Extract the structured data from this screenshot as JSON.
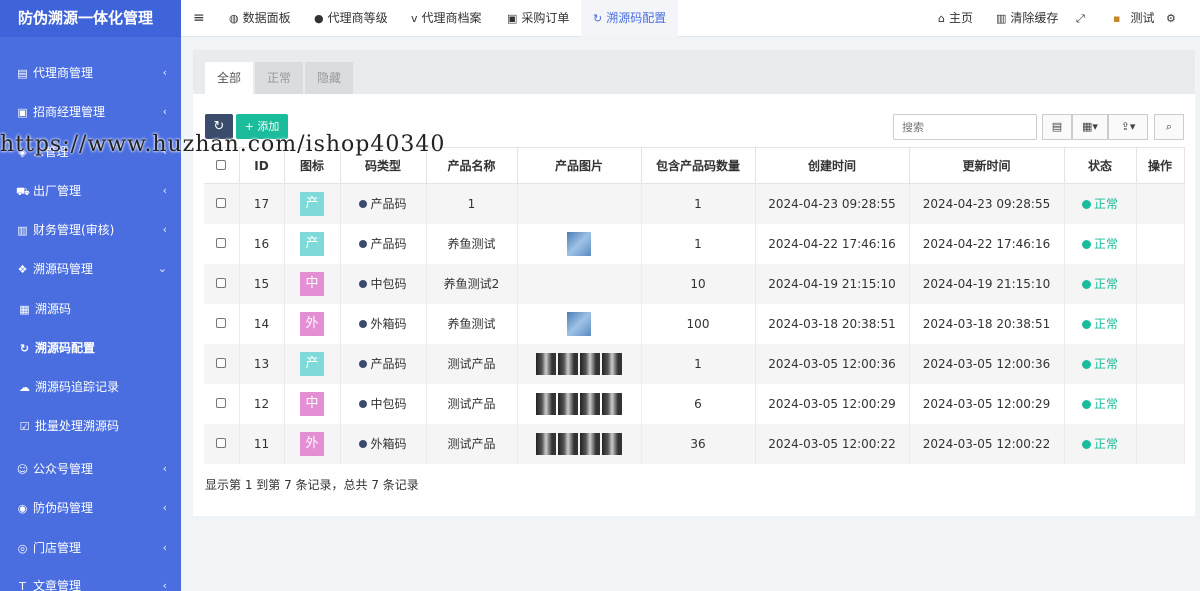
{
  "app_title": "防伪溯源一体化管理",
  "sidebar": {
    "items": [
      {
        "icon": "id-card-icon",
        "glyph": "▤",
        "label": "代理商管理",
        "arrow": "‹"
      },
      {
        "icon": "user-tie-icon",
        "glyph": "▣",
        "label": "招商经理管理",
        "arrow": "‹"
      },
      {
        "icon": "box-icon",
        "glyph": "◈",
        "label": "...管理",
        "arrow": "‹"
      },
      {
        "icon": "truck-icon",
        "glyph": "⛟",
        "label": "出厂管理",
        "arrow": "‹"
      },
      {
        "icon": "finance-icon",
        "glyph": "▥",
        "label": "财务管理(审核)",
        "arrow": "‹"
      },
      {
        "icon": "cubes-icon",
        "glyph": "❖",
        "label": "溯源码管理",
        "arrow": "⌄"
      },
      {
        "icon": "barcode-icon",
        "glyph": "▦",
        "label": "溯源码",
        "arrow": ""
      },
      {
        "icon": "refresh-icon",
        "glyph": "↻",
        "label": "溯源码配置",
        "arrow": ""
      },
      {
        "icon": "cloud-icon",
        "glyph": "☁",
        "label": "溯源码追踪记录",
        "arrow": ""
      },
      {
        "icon": "check-square-icon",
        "glyph": "☑",
        "label": "批量处理溯源码",
        "arrow": ""
      },
      {
        "icon": "wechat-icon",
        "glyph": "☺",
        "label": "公众号管理",
        "arrow": "‹"
      },
      {
        "icon": "shield-icon",
        "glyph": "◉",
        "label": "防伪码管理",
        "arrow": "‹"
      },
      {
        "icon": "store-icon",
        "glyph": "◎",
        "label": "门店管理",
        "arrow": "‹"
      },
      {
        "icon": "text-icon",
        "glyph": "T",
        "label": "文章管理",
        "arrow": "‹"
      }
    ]
  },
  "topnav": {
    "menu_glyph": "≡",
    "items": [
      {
        "glyph": "◍",
        "label": "数据面板"
      },
      {
        "glyph": "●",
        "label": "代理商等级"
      },
      {
        "glyph": "v",
        "label": "代理商档案"
      },
      {
        "glyph": "▣",
        "label": "采购订单"
      },
      {
        "glyph": "↻",
        "label": "溯源码配置"
      }
    ],
    "right": [
      {
        "glyph": "⌂",
        "label": "主页"
      },
      {
        "glyph": "▥",
        "label": "清除缓存"
      },
      {
        "glyph": "⤢",
        "label": ""
      },
      {
        "glyph": "▪",
        "label": "测试"
      },
      {
        "glyph": "⚙",
        "label": ""
      }
    ]
  },
  "tabs": [
    "全部",
    "正常",
    "隐藏"
  ],
  "toolbar": {
    "refresh_glyph": "↻",
    "add_label": "+ 添加",
    "search_placeholder": "搜索",
    "tool1": "▤",
    "tool2": "▦▾",
    "tool3": "⇪▾",
    "tool4": "⌕"
  },
  "table": {
    "headers": [
      "",
      "ID",
      "图标",
      "码类型",
      "产品名称",
      "产品图片",
      "包含产品码数量",
      "创建时间",
      "更新时间",
      "状态",
      "操作"
    ],
    "rows": [
      {
        "id": "17",
        "icon": "产",
        "icon_color": "#7fd9d9",
        "type": "产品码",
        "name": "1",
        "pic": "none",
        "count": "1",
        "created": "2024-04-23 09:28:55",
        "updated": "2024-04-23 09:28:55",
        "status": "正常"
      },
      {
        "id": "16",
        "icon": "产",
        "icon_color": "#7fd9d9",
        "type": "产品码",
        "name": "养鱼测试",
        "pic": "thumb",
        "count": "1",
        "created": "2024-04-22 17:46:16",
        "updated": "2024-04-22 17:46:16",
        "status": "正常"
      },
      {
        "id": "15",
        "icon": "中",
        "icon_color": "#e48fd3",
        "type": "中包码",
        "name": "养鱼测试2",
        "pic": "none",
        "count": "10",
        "created": "2024-04-19 21:15:10",
        "updated": "2024-04-19 21:15:10",
        "status": "正常"
      },
      {
        "id": "14",
        "icon": "外",
        "icon_color": "#e48fd3",
        "type": "外箱码",
        "name": "养鱼测试",
        "pic": "thumb",
        "count": "100",
        "created": "2024-03-18 20:38:51",
        "updated": "2024-03-18 20:38:51",
        "status": "正常"
      },
      {
        "id": "13",
        "icon": "产",
        "icon_color": "#7fd9d9",
        "type": "产品码",
        "name": "测试产品",
        "pic": "multi",
        "count": "1",
        "created": "2024-03-05 12:00:36",
        "updated": "2024-03-05 12:00:36",
        "status": "正常"
      },
      {
        "id": "12",
        "icon": "中",
        "icon_color": "#e48fd3",
        "type": "中包码",
        "name": "测试产品",
        "pic": "multi",
        "count": "6",
        "created": "2024-03-05 12:00:29",
        "updated": "2024-03-05 12:00:29",
        "status": "正常"
      },
      {
        "id": "11",
        "icon": "外",
        "icon_color": "#e48fd3",
        "type": "外箱码",
        "name": "测试产品",
        "pic": "multi",
        "count": "36",
        "created": "2024-03-05 12:00:22",
        "updated": "2024-03-05 12:00:22",
        "status": "正常"
      }
    ]
  },
  "footer_text": "显示第 1 到第 7 条记录，总共 7 条记录",
  "watermark": "https://www.huzhan.com/ishop40340",
  "colors": {
    "sidebar": "#4a6ee0",
    "accent": "#4a6ee0",
    "success": "#1bbc9b",
    "dark_btn": "#3a4b6b"
  }
}
